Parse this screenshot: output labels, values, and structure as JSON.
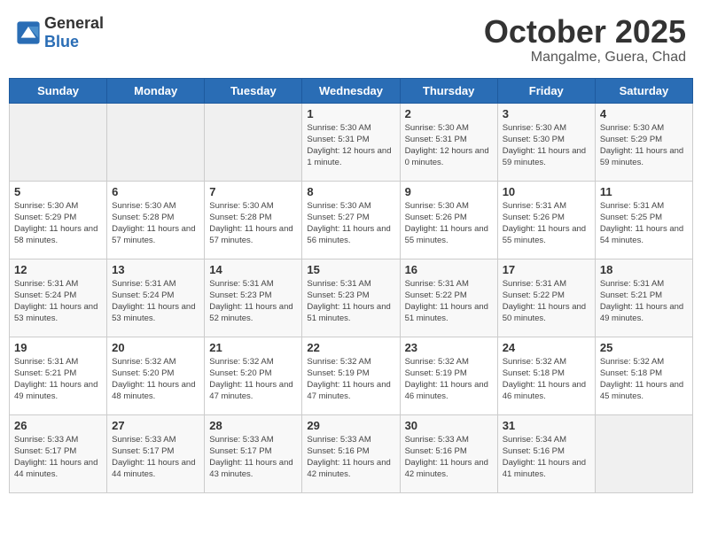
{
  "header": {
    "logo_general": "General",
    "logo_blue": "Blue",
    "month": "October 2025",
    "location": "Mangalme, Guera, Chad"
  },
  "weekdays": [
    "Sunday",
    "Monday",
    "Tuesday",
    "Wednesday",
    "Thursday",
    "Friday",
    "Saturday"
  ],
  "weeks": [
    [
      {
        "day": "",
        "info": ""
      },
      {
        "day": "",
        "info": ""
      },
      {
        "day": "",
        "info": ""
      },
      {
        "day": "1",
        "info": "Sunrise: 5:30 AM\nSunset: 5:31 PM\nDaylight: 12 hours\nand 1 minute."
      },
      {
        "day": "2",
        "info": "Sunrise: 5:30 AM\nSunset: 5:31 PM\nDaylight: 12 hours\nand 0 minutes."
      },
      {
        "day": "3",
        "info": "Sunrise: 5:30 AM\nSunset: 5:30 PM\nDaylight: 11 hours\nand 59 minutes."
      },
      {
        "day": "4",
        "info": "Sunrise: 5:30 AM\nSunset: 5:29 PM\nDaylight: 11 hours\nand 59 minutes."
      }
    ],
    [
      {
        "day": "5",
        "info": "Sunrise: 5:30 AM\nSunset: 5:29 PM\nDaylight: 11 hours\nand 58 minutes."
      },
      {
        "day": "6",
        "info": "Sunrise: 5:30 AM\nSunset: 5:28 PM\nDaylight: 11 hours\nand 57 minutes."
      },
      {
        "day": "7",
        "info": "Sunrise: 5:30 AM\nSunset: 5:28 PM\nDaylight: 11 hours\nand 57 minutes."
      },
      {
        "day": "8",
        "info": "Sunrise: 5:30 AM\nSunset: 5:27 PM\nDaylight: 11 hours\nand 56 minutes."
      },
      {
        "day": "9",
        "info": "Sunrise: 5:30 AM\nSunset: 5:26 PM\nDaylight: 11 hours\nand 55 minutes."
      },
      {
        "day": "10",
        "info": "Sunrise: 5:31 AM\nSunset: 5:26 PM\nDaylight: 11 hours\nand 55 minutes."
      },
      {
        "day": "11",
        "info": "Sunrise: 5:31 AM\nSunset: 5:25 PM\nDaylight: 11 hours\nand 54 minutes."
      }
    ],
    [
      {
        "day": "12",
        "info": "Sunrise: 5:31 AM\nSunset: 5:24 PM\nDaylight: 11 hours\nand 53 minutes."
      },
      {
        "day": "13",
        "info": "Sunrise: 5:31 AM\nSunset: 5:24 PM\nDaylight: 11 hours\nand 53 minutes."
      },
      {
        "day": "14",
        "info": "Sunrise: 5:31 AM\nSunset: 5:23 PM\nDaylight: 11 hours\nand 52 minutes."
      },
      {
        "day": "15",
        "info": "Sunrise: 5:31 AM\nSunset: 5:23 PM\nDaylight: 11 hours\nand 51 minutes."
      },
      {
        "day": "16",
        "info": "Sunrise: 5:31 AM\nSunset: 5:22 PM\nDaylight: 11 hours\nand 51 minutes."
      },
      {
        "day": "17",
        "info": "Sunrise: 5:31 AM\nSunset: 5:22 PM\nDaylight: 11 hours\nand 50 minutes."
      },
      {
        "day": "18",
        "info": "Sunrise: 5:31 AM\nSunset: 5:21 PM\nDaylight: 11 hours\nand 49 minutes."
      }
    ],
    [
      {
        "day": "19",
        "info": "Sunrise: 5:31 AM\nSunset: 5:21 PM\nDaylight: 11 hours\nand 49 minutes."
      },
      {
        "day": "20",
        "info": "Sunrise: 5:32 AM\nSunset: 5:20 PM\nDaylight: 11 hours\nand 48 minutes."
      },
      {
        "day": "21",
        "info": "Sunrise: 5:32 AM\nSunset: 5:20 PM\nDaylight: 11 hours\nand 47 minutes."
      },
      {
        "day": "22",
        "info": "Sunrise: 5:32 AM\nSunset: 5:19 PM\nDaylight: 11 hours\nand 47 minutes."
      },
      {
        "day": "23",
        "info": "Sunrise: 5:32 AM\nSunset: 5:19 PM\nDaylight: 11 hours\nand 46 minutes."
      },
      {
        "day": "24",
        "info": "Sunrise: 5:32 AM\nSunset: 5:18 PM\nDaylight: 11 hours\nand 46 minutes."
      },
      {
        "day": "25",
        "info": "Sunrise: 5:32 AM\nSunset: 5:18 PM\nDaylight: 11 hours\nand 45 minutes."
      }
    ],
    [
      {
        "day": "26",
        "info": "Sunrise: 5:33 AM\nSunset: 5:17 PM\nDaylight: 11 hours\nand 44 minutes."
      },
      {
        "day": "27",
        "info": "Sunrise: 5:33 AM\nSunset: 5:17 PM\nDaylight: 11 hours\nand 44 minutes."
      },
      {
        "day": "28",
        "info": "Sunrise: 5:33 AM\nSunset: 5:17 PM\nDaylight: 11 hours\nand 43 minutes."
      },
      {
        "day": "29",
        "info": "Sunrise: 5:33 AM\nSunset: 5:16 PM\nDaylight: 11 hours\nand 42 minutes."
      },
      {
        "day": "30",
        "info": "Sunrise: 5:33 AM\nSunset: 5:16 PM\nDaylight: 11 hours\nand 42 minutes."
      },
      {
        "day": "31",
        "info": "Sunrise: 5:34 AM\nSunset: 5:16 PM\nDaylight: 11 hours\nand 41 minutes."
      },
      {
        "day": "",
        "info": ""
      }
    ]
  ]
}
